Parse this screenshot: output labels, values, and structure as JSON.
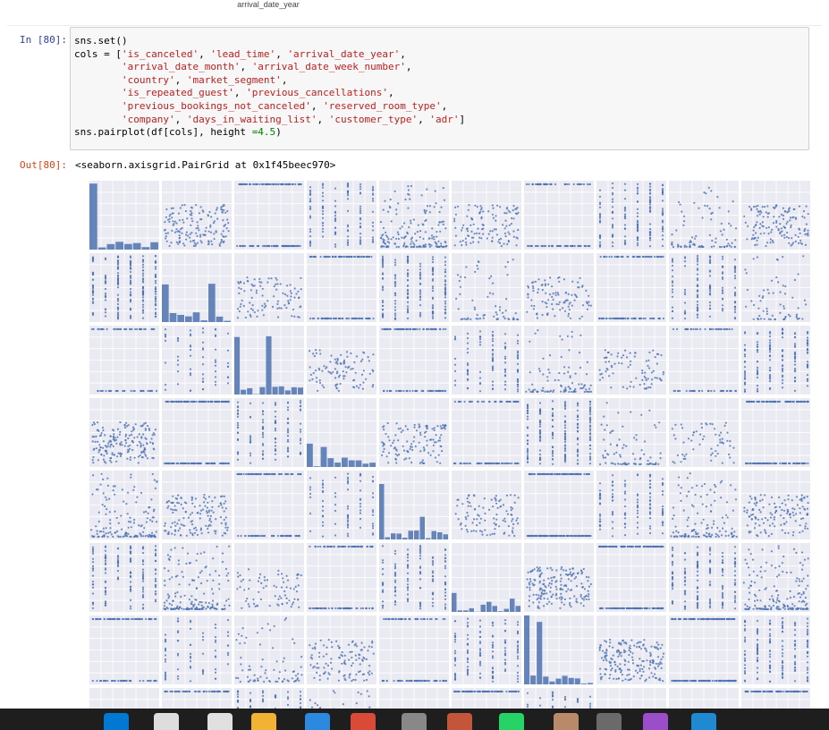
{
  "top_axis_label": "arrival_date_year",
  "input_cell": {
    "prompt": "In [80]:",
    "code_lines": [
      [
        {
          "t": "sns.set()"
        }
      ],
      [
        {
          "t": "cols = ["
        },
        {
          "t": "'is_canceled'",
          "c": "s"
        },
        {
          "t": ", "
        },
        {
          "t": "'lead_time'",
          "c": "s"
        },
        {
          "t": ", "
        },
        {
          "t": "'arrival_date_year'",
          "c": "s"
        },
        {
          "t": ","
        }
      ],
      [
        {
          "t": "        "
        },
        {
          "t": "'arrival_date_month'",
          "c": "s"
        },
        {
          "t": ", "
        },
        {
          "t": "'arrival_date_week_number'",
          "c": "s"
        },
        {
          "t": ","
        }
      ],
      [
        {
          "t": "        "
        },
        {
          "t": "'country'",
          "c": "s"
        },
        {
          "t": ", "
        },
        {
          "t": "'market_segment'",
          "c": "s"
        },
        {
          "t": ","
        }
      ],
      [
        {
          "t": "        "
        },
        {
          "t": "'is_repeated_guest'",
          "c": "s"
        },
        {
          "t": ", "
        },
        {
          "t": "'previous_cancellations'",
          "c": "s"
        },
        {
          "t": ","
        }
      ],
      [
        {
          "t": "        "
        },
        {
          "t": "'previous_bookings_not_canceled'",
          "c": "s"
        },
        {
          "t": ", "
        },
        {
          "t": "'reserved_room_type'",
          "c": "s"
        },
        {
          "t": ","
        }
      ],
      [
        {
          "t": "        "
        },
        {
          "t": "'company'",
          "c": "s"
        },
        {
          "t": ", "
        },
        {
          "t": "'days_in_waiting_list'",
          "c": "s"
        },
        {
          "t": ", "
        },
        {
          "t": "'customer_type'",
          "c": "s"
        },
        {
          "t": ", "
        },
        {
          "t": "'adr'",
          "c": "s"
        },
        {
          "t": "]"
        }
      ],
      [
        {
          "t": "sns.pairplot(df[cols], height "
        },
        {
          "t": "=4.5",
          "c": "n"
        },
        {
          "t": ")"
        }
      ]
    ]
  },
  "output_cell": {
    "prompt": "Out[80]:",
    "text": "<seaborn.axisgrid.PairGrid at 0x1f45beec970>"
  },
  "figure": {
    "background": "#eaeaf2",
    "point_color": "#4c72b0",
    "columns": 10,
    "visible_rows": 8
  },
  "taskbar": {
    "icons": [
      "windows-start-icon",
      "search-icon",
      "file-icon",
      "folder-icon",
      "notes-icon",
      "red-app-icon",
      "window-app-icon",
      "settings-icon",
      "whatsapp-icon",
      "user-avatar-icon",
      "monitor-icon",
      "purple-app-icon",
      "vscode-icon"
    ],
    "colors": [
      "#0078d4",
      "#dddddd",
      "#e0e0e0",
      "#f2b233",
      "#2b8ae0",
      "#d94a38",
      "#888888",
      "#c2553a",
      "#25d366",
      "#b98a6a",
      "#6a6a6a",
      "#9b4dca",
      "#1f8ad2"
    ]
  }
}
